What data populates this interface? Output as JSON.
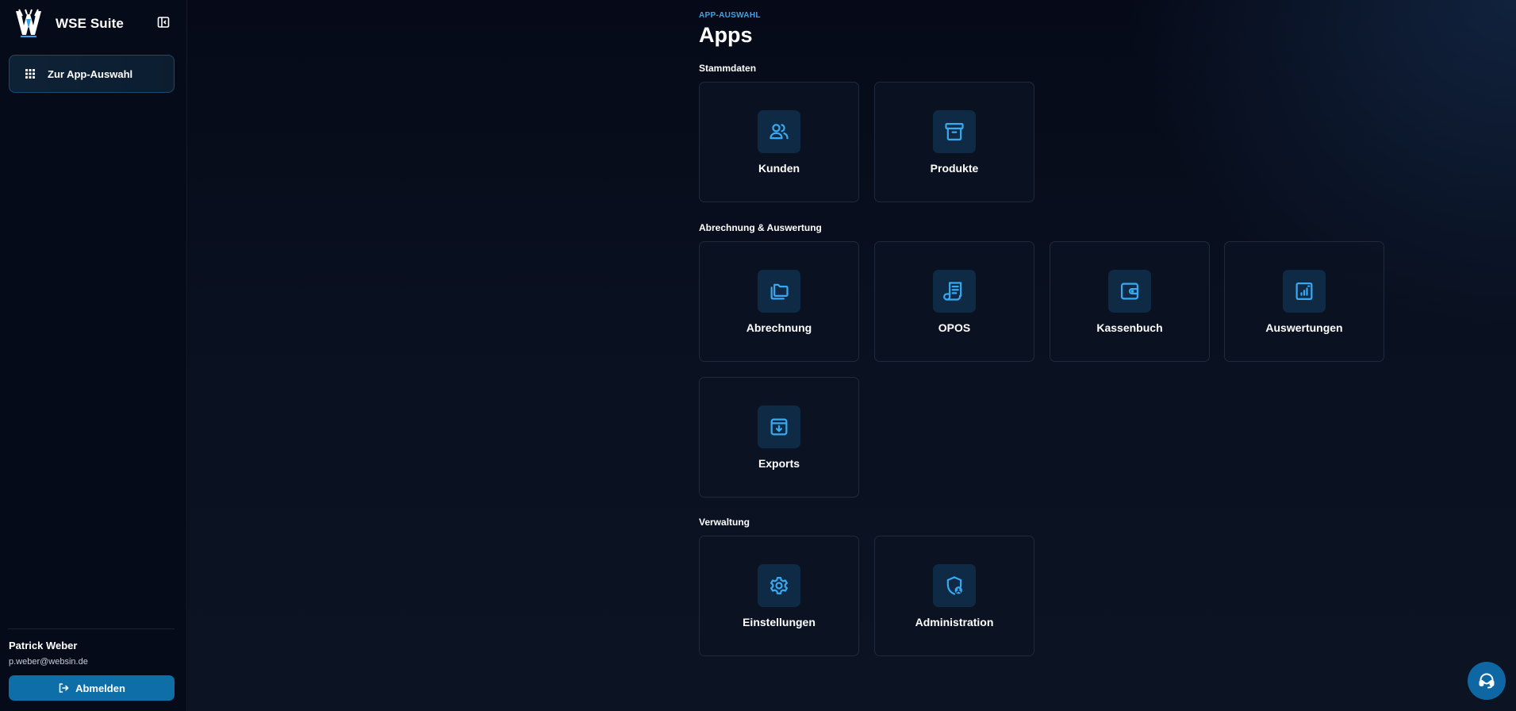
{
  "app": {
    "name": "WSE Suite"
  },
  "sidebar": {
    "nav": {
      "label": "Zur App-Auswahl",
      "icon": "grid-icon"
    },
    "user": {
      "name": "Patrick Weber",
      "email": "p.weber@websin.de"
    },
    "logout_label": "Abmelden"
  },
  "main": {
    "eyebrow": "APP-AUSWAHL",
    "title": "Apps",
    "sections": [
      {
        "title": "Stammdaten",
        "apps": [
          {
            "label": "Kunden",
            "icon": "users-icon"
          },
          {
            "label": "Produkte",
            "icon": "archive-icon"
          }
        ]
      },
      {
        "title": "Abrechnung & Auswertung",
        "apps": [
          {
            "label": "Abrechnung",
            "icon": "folders-icon"
          },
          {
            "label": "OPOS",
            "icon": "receipt-icon"
          },
          {
            "label": "Kassenbuch",
            "icon": "wallet-icon"
          },
          {
            "label": "Auswertungen",
            "icon": "report-chart-icon"
          },
          {
            "label": "Exports",
            "icon": "archive-download-icon"
          }
        ]
      },
      {
        "title": "Verwaltung",
        "apps": [
          {
            "label": "Einstellungen",
            "icon": "gear-icon"
          },
          {
            "label": "Administration",
            "icon": "shield-user-icon"
          }
        ]
      }
    ]
  },
  "colors": {
    "accent": "#38a9f0",
    "tile_icon_bg": "#0f2a45",
    "primary_button": "#0d6ea8"
  }
}
